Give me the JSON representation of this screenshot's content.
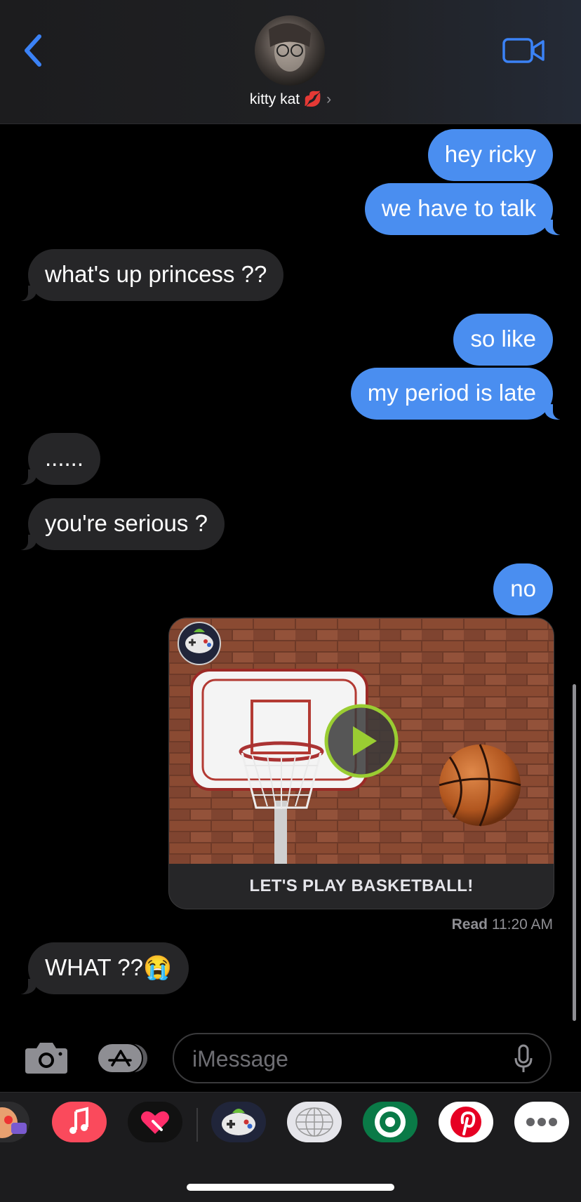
{
  "header": {
    "contact_name": "kitty kat 💋",
    "chevron": "›",
    "back_icon": "chevron-left-icon",
    "video_icon": "video-camera-icon"
  },
  "messages": [
    {
      "id": "m1",
      "direction": "out",
      "text": "hey ricky"
    },
    {
      "id": "m2",
      "direction": "out",
      "text": "we have to talk"
    },
    {
      "id": "m3",
      "direction": "in",
      "text": "what's up princess  ??"
    },
    {
      "id": "m4",
      "direction": "out",
      "text": "so like"
    },
    {
      "id": "m5",
      "direction": "out",
      "text": "my period is late"
    },
    {
      "id": "m6",
      "direction": "in",
      "text": "......"
    },
    {
      "id": "m7",
      "direction": "in",
      "text": "you're serious ?"
    },
    {
      "id": "m8",
      "direction": "out",
      "text": "no"
    },
    {
      "id": "m10",
      "direction": "in",
      "text": "WHAT ??😭"
    }
  ],
  "game_card": {
    "caption": "LET'S PLAY BASKETBALL!",
    "play_icon": "play-icon",
    "app_badge_icon": "game-pigeon-icon"
  },
  "receipt": {
    "status": "Read",
    "time": "11:20 AM"
  },
  "input": {
    "placeholder": "iMessage",
    "camera_icon": "camera-icon",
    "apps_icon": "app-store-icon",
    "mic_icon": "microphone-icon"
  },
  "drawer_apps": [
    {
      "name": "memoji-stickers-icon"
    },
    {
      "name": "apple-music-icon",
      "color": "#fa4a5c"
    },
    {
      "name": "digital-touch-icon"
    },
    {
      "name": "game-pigeon-icon"
    },
    {
      "name": "globe-app-icon"
    },
    {
      "name": "starbucks-icon",
      "color": "#0a7a47"
    },
    {
      "name": "pinterest-icon",
      "color": "#e60023"
    },
    {
      "name": "more-apps-icon"
    }
  ],
  "colors": {
    "outgoing_bubble": "#4a8ef0",
    "incoming_bubble": "#262628",
    "accent": "#3b82f6"
  }
}
